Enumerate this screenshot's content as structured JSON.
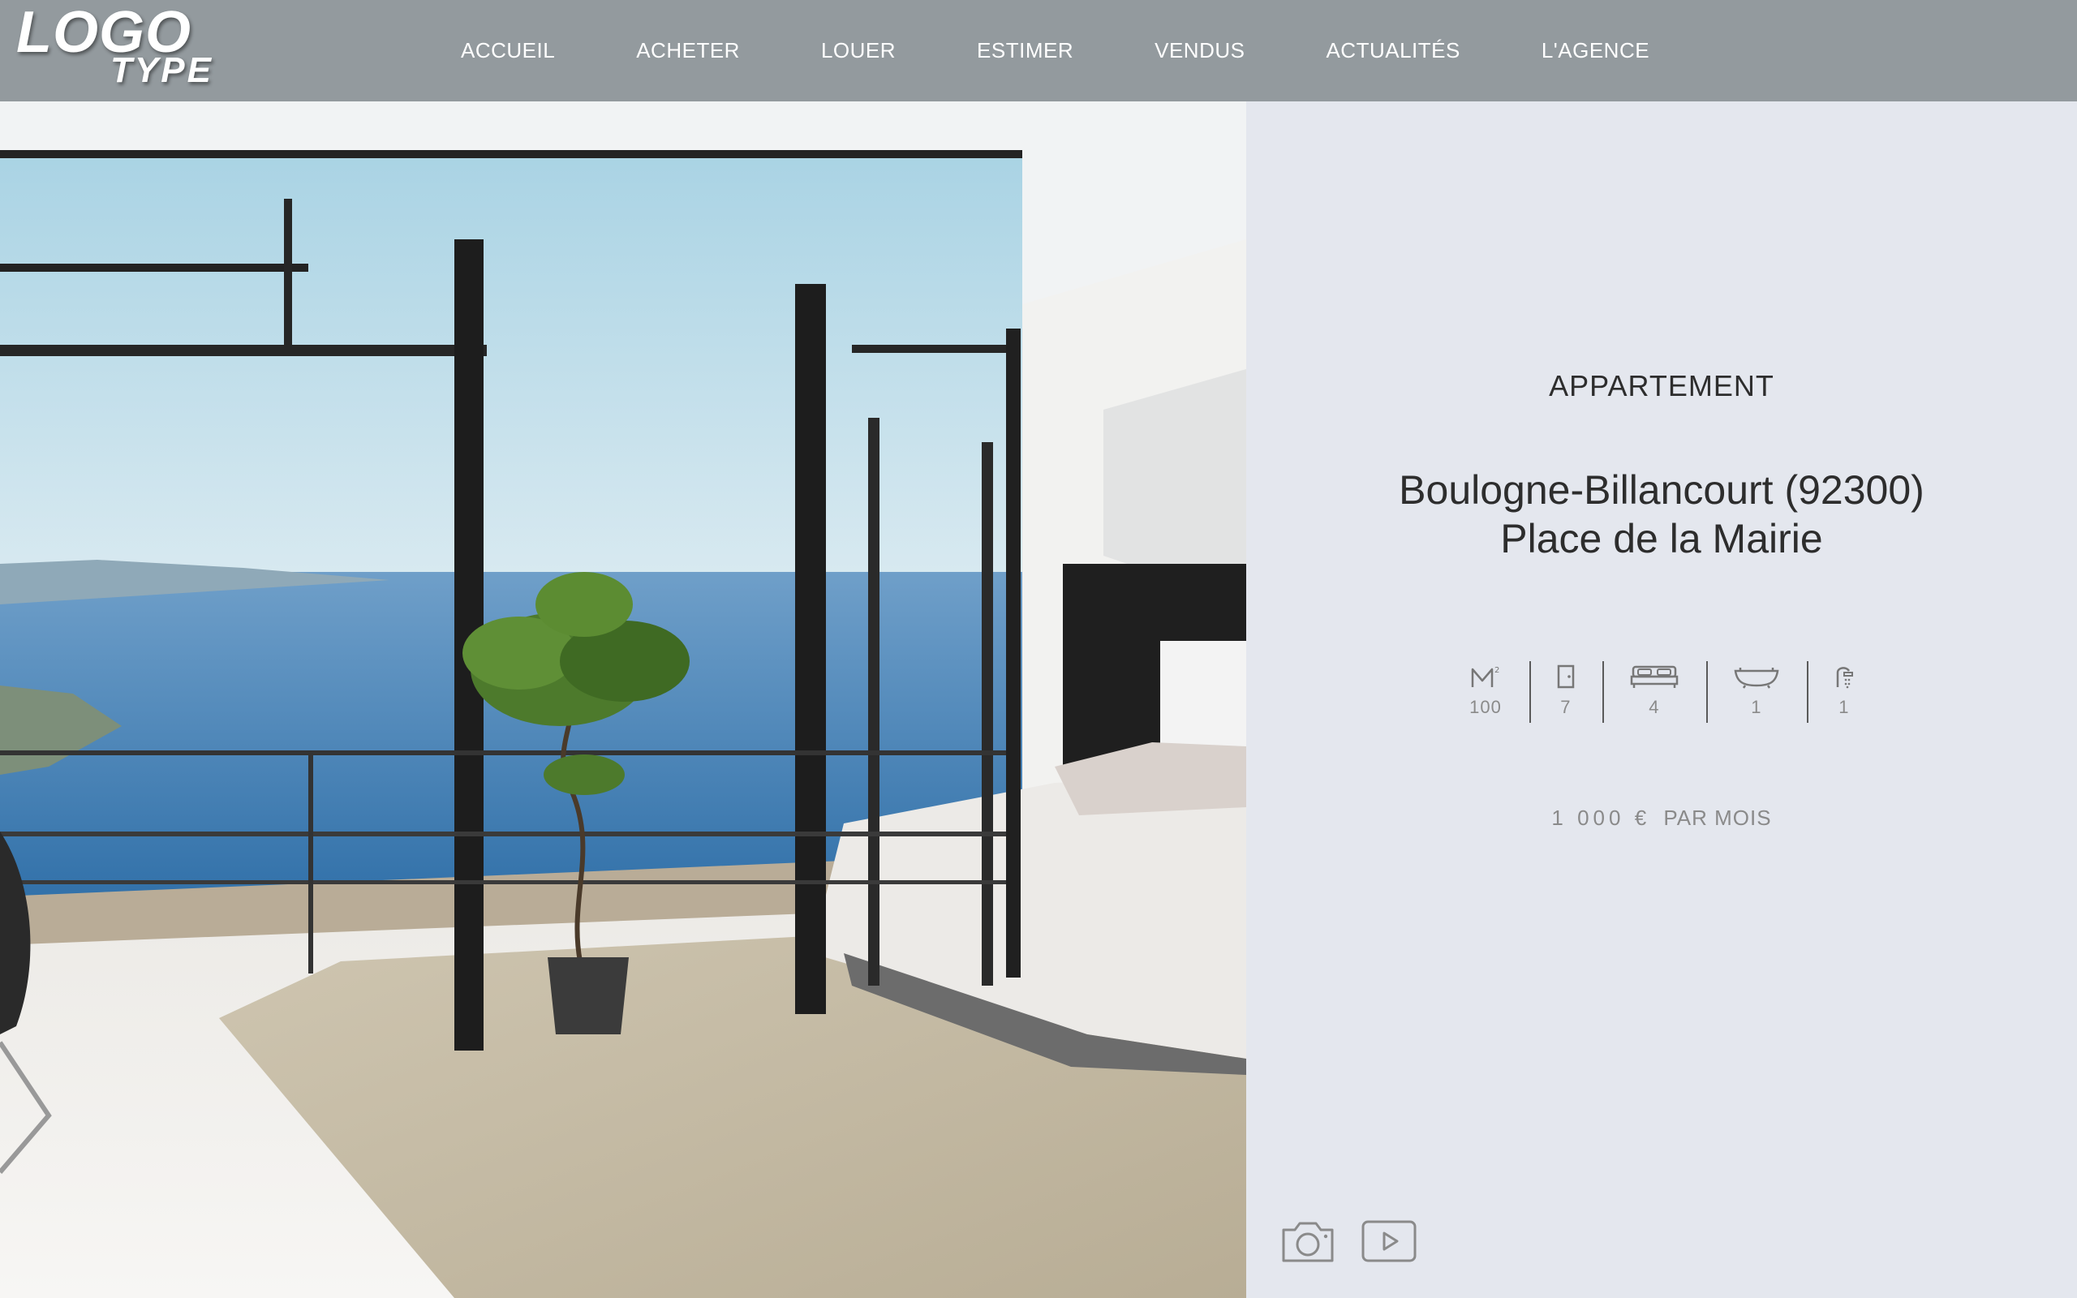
{
  "logo": {
    "line1": "LOGO",
    "line2": "TYPE"
  },
  "nav": [
    {
      "label": "ACCUEIL"
    },
    {
      "label": "ACHETER"
    },
    {
      "label": "LOUER"
    },
    {
      "label": "ESTIMER"
    },
    {
      "label": "VENDUS"
    },
    {
      "label": "ACTUALITÉS"
    },
    {
      "label": "L'AGENCE"
    }
  ],
  "property": {
    "type": "APPARTEMENT",
    "city": "Boulogne-Billancourt (92300)",
    "street": "Place de la Mairie",
    "features": [
      {
        "icon": "surface-m2-icon",
        "value": "100"
      },
      {
        "icon": "door-rooms-icon",
        "value": "7"
      },
      {
        "icon": "bed-icon",
        "value": "4"
      },
      {
        "icon": "bathtub-icon",
        "value": "1"
      },
      {
        "icon": "shower-icon",
        "value": "1"
      }
    ],
    "price_amount": "1 000 €",
    "price_period": "PAR MOIS"
  },
  "media": {
    "photo_icon": "camera-icon",
    "video_icon": "video-play-icon"
  },
  "colors": {
    "header_bg": "#939a9e",
    "panel_bg": "#e4e7ee",
    "text_dark": "#2d2d2d",
    "text_muted": "#8a8a8a"
  }
}
